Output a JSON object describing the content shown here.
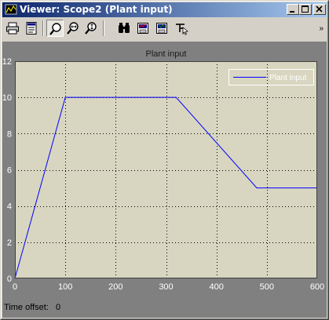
{
  "window": {
    "title": "Viewer: Scope2 (Plant input)"
  },
  "titlebar_buttons": [
    {
      "name": "minimize-button",
      "icon": "minimize-icon"
    },
    {
      "name": "maximize-button",
      "icon": "maximize-icon"
    },
    {
      "name": "close-button",
      "icon": "close-icon"
    }
  ],
  "toolbar": {
    "items": [
      {
        "name": "print-button",
        "icon": "printer-icon"
      },
      {
        "name": "parameters-button",
        "icon": "parameters-icon"
      },
      {
        "name": "zoom-button",
        "icon": "zoom-icon",
        "pressed": true
      },
      {
        "name": "zoom-x-button",
        "icon": "zoom-x-icon"
      },
      {
        "name": "zoom-y-button",
        "icon": "zoom-y-icon"
      },
      {
        "name": "autoscale-button",
        "icon": "binoculars-icon"
      },
      {
        "name": "save-axes-button",
        "icon": "save-axes-icon"
      },
      {
        "name": "restore-axes-button",
        "icon": "restore-axes-icon"
      },
      {
        "name": "signal-selector-button",
        "icon": "signal-selector-icon"
      }
    ],
    "menu_glyph": "»"
  },
  "colors": {
    "plot_bg": "#d8d6c0",
    "frame_bg": "#808080",
    "line": "#0000ff"
  },
  "footer": {
    "label": "Time offset:",
    "value": "0"
  },
  "chart_data": {
    "type": "line",
    "title": "Plant input",
    "xlabel": "",
    "ylabel": "",
    "xlim": [
      0,
      600
    ],
    "ylim": [
      0,
      12
    ],
    "xticks": [
      0,
      100,
      200,
      300,
      400,
      500,
      600
    ],
    "yticks": [
      0,
      2,
      4,
      6,
      8,
      10,
      12
    ],
    "grid": true,
    "legend_position": "top-right",
    "series": [
      {
        "name": "Plant input",
        "x": [
          0,
          100,
          320,
          480,
          600
        ],
        "y": [
          0,
          10,
          10,
          5,
          5
        ]
      }
    ]
  }
}
